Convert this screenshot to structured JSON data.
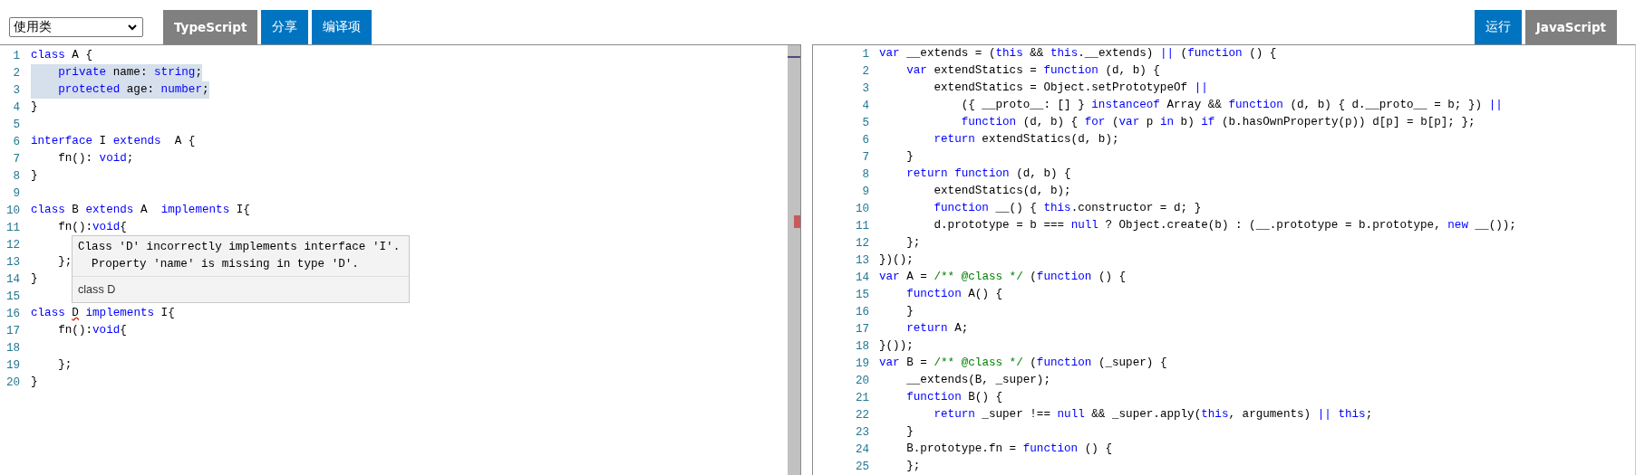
{
  "toolbar": {
    "select": {
      "value": "使用类"
    },
    "left_buttons": [
      {
        "label": "TypeScript",
        "kind": "language"
      },
      {
        "label": "分享",
        "kind": "action"
      },
      {
        "label": "编译项",
        "kind": "action"
      }
    ],
    "right_buttons": [
      {
        "label": "运行",
        "kind": "action"
      },
      {
        "label": "JavaScript",
        "kind": "language"
      }
    ]
  },
  "source_editor": {
    "lines": [
      {
        "number": "1",
        "selected": false,
        "tokens": [
          {
            "kind": "keyword",
            "text": "class"
          },
          {
            "kind": "plain",
            "text": " A {"
          }
        ]
      },
      {
        "number": "2",
        "selected": true,
        "tokens": [
          {
            "kind": "keyword",
            "text": "    private"
          },
          {
            "kind": "plain",
            "text": " name: "
          },
          {
            "kind": "keyword",
            "text": "string"
          },
          {
            "kind": "plain",
            "text": ";"
          }
        ]
      },
      {
        "number": "3",
        "selected": true,
        "tokens": [
          {
            "kind": "keyword",
            "text": "    protected"
          },
          {
            "kind": "plain",
            "text": " age: "
          },
          {
            "kind": "keyword",
            "text": "number"
          },
          {
            "kind": "plain",
            "text": ";"
          }
        ]
      },
      {
        "number": "4",
        "selected": false,
        "tokens": [
          {
            "kind": "plain",
            "text": "}"
          }
        ]
      },
      {
        "number": "5",
        "selected": false
      },
      {
        "number": "6",
        "selected": false,
        "tokens": [
          {
            "kind": "keyword",
            "text": "interface"
          },
          {
            "kind": "plain",
            "text": " I "
          },
          {
            "kind": "keyword",
            "text": "extends"
          },
          {
            "kind": "plain",
            "text": "  A {"
          }
        ]
      },
      {
        "number": "7",
        "selected": false,
        "tokens": [
          {
            "kind": "plain",
            "text": "    fn(): "
          },
          {
            "kind": "keyword",
            "text": "void"
          },
          {
            "kind": "plain",
            "text": ";"
          }
        ]
      },
      {
        "number": "8",
        "selected": false,
        "tokens": [
          {
            "kind": "plain",
            "text": "}"
          }
        ]
      },
      {
        "number": "9",
        "selected": false
      },
      {
        "number": "10",
        "selected": false,
        "tokens": [
          {
            "kind": "keyword",
            "text": "class"
          },
          {
            "kind": "plain",
            "text": " B "
          },
          {
            "kind": "keyword",
            "text": "extends"
          },
          {
            "kind": "plain",
            "text": " A  "
          },
          {
            "kind": "keyword",
            "text": "implements"
          },
          {
            "kind": "plain",
            "text": " I{"
          }
        ]
      },
      {
        "number": "11",
        "selected": false,
        "tokens": [
          {
            "kind": "plain",
            "text": "    fn():"
          },
          {
            "kind": "keyword",
            "text": "void"
          },
          {
            "kind": "plain",
            "text": "{"
          }
        ]
      },
      {
        "number": "12",
        "selected": false
      },
      {
        "number": "13",
        "selected": false,
        "tokens": [
          {
            "kind": "plain",
            "text": "    };"
          }
        ]
      },
      {
        "number": "14",
        "selected": false,
        "tokens": [
          {
            "kind": "plain",
            "text": "}"
          }
        ]
      },
      {
        "number": "15",
        "selected": false
      },
      {
        "number": "16",
        "selected": false,
        "tokens": [
          {
            "kind": "keyword",
            "text": "class "
          },
          {
            "kind": "error",
            "text": "D"
          },
          {
            "kind": "keyword",
            "text": " implements"
          },
          {
            "kind": "plain",
            "text": " I{"
          }
        ]
      },
      {
        "number": "17",
        "selected": false,
        "tokens": [
          {
            "kind": "plain",
            "text": "    fn():"
          },
          {
            "kind": "keyword",
            "text": "void"
          },
          {
            "kind": "plain",
            "text": "{"
          }
        ]
      },
      {
        "number": "18",
        "selected": false
      },
      {
        "number": "19",
        "selected": false,
        "tokens": [
          {
            "kind": "plain",
            "text": "    };"
          }
        ]
      },
      {
        "number": "20",
        "selected": false,
        "tokens": [
          {
            "kind": "plain",
            "text": "}"
          }
        ]
      }
    ],
    "tooltip": {
      "message": [
        "Class 'D' incorrectly implements interface 'I'.",
        "  Property 'name' is missing in type 'D'."
      ],
      "footer": "class D"
    }
  },
  "output_editor": {
    "lines": [
      {
        "number": "1",
        "tokens": [
          {
            "kind": "keyword",
            "text": "var"
          },
          {
            "kind": "plain",
            "text": " __extends = ("
          },
          {
            "kind": "keyword",
            "text": "this"
          },
          {
            "kind": "plain",
            "text": " && "
          },
          {
            "kind": "keyword",
            "text": "this"
          },
          {
            "kind": "plain",
            "text": ".__extends) "
          },
          {
            "kind": "keyword",
            "text": "||"
          },
          {
            "kind": "plain",
            "text": " ("
          },
          {
            "kind": "keyword",
            "text": "function"
          },
          {
            "kind": "plain",
            "text": " () {"
          }
        ]
      },
      {
        "number": "2",
        "tokens": [
          {
            "kind": "keyword",
            "text": "    var"
          },
          {
            "kind": "plain",
            "text": " extendStatics = "
          },
          {
            "kind": "keyword",
            "text": "function"
          },
          {
            "kind": "plain",
            "text": " (d, b) {"
          }
        ]
      },
      {
        "number": "3",
        "tokens": [
          {
            "kind": "plain",
            "text": "        extendStatics = Object.setPrototypeOf "
          },
          {
            "kind": "keyword",
            "text": "||"
          }
        ]
      },
      {
        "number": "4",
        "tokens": [
          {
            "kind": "plain",
            "text": "            ({ __proto__: [] } "
          },
          {
            "kind": "keyword",
            "text": "instanceof"
          },
          {
            "kind": "plain",
            "text": " Array && "
          },
          {
            "kind": "keyword",
            "text": "function"
          },
          {
            "kind": "plain",
            "text": " (d, b) { d.__proto__ = b; }) "
          },
          {
            "kind": "keyword",
            "text": "||"
          }
        ]
      },
      {
        "number": "5",
        "tokens": [
          {
            "kind": "keyword",
            "text": "            function"
          },
          {
            "kind": "plain",
            "text": " (d, b) { "
          },
          {
            "kind": "keyword",
            "text": "for"
          },
          {
            "kind": "plain",
            "text": " ("
          },
          {
            "kind": "keyword",
            "text": "var"
          },
          {
            "kind": "plain",
            "text": " p "
          },
          {
            "kind": "keyword",
            "text": "in"
          },
          {
            "kind": "plain",
            "text": " b) "
          },
          {
            "kind": "keyword",
            "text": "if"
          },
          {
            "kind": "plain",
            "text": " (b.hasOwnProperty(p)) d[p] = b[p]; };"
          }
        ]
      },
      {
        "number": "6",
        "tokens": [
          {
            "kind": "keyword",
            "text": "        return"
          },
          {
            "kind": "plain",
            "text": " extendStatics(d, b);"
          }
        ]
      },
      {
        "number": "7",
        "tokens": [
          {
            "kind": "plain",
            "text": "    }"
          }
        ]
      },
      {
        "number": "8",
        "tokens": [
          {
            "kind": "keyword",
            "text": "    return function"
          },
          {
            "kind": "plain",
            "text": " (d, b) {"
          }
        ]
      },
      {
        "number": "9",
        "tokens": [
          {
            "kind": "plain",
            "text": "        extendStatics(d, b);"
          }
        ]
      },
      {
        "number": "10",
        "tokens": [
          {
            "kind": "keyword",
            "text": "        function"
          },
          {
            "kind": "plain",
            "text": " __() { "
          },
          {
            "kind": "keyword",
            "text": "this"
          },
          {
            "kind": "plain",
            "text": ".constructor = d; }"
          }
        ]
      },
      {
        "number": "11",
        "tokens": [
          {
            "kind": "plain",
            "text": "        d.prototype = b === "
          },
          {
            "kind": "keyword",
            "text": "null"
          },
          {
            "kind": "plain",
            "text": " ? Object.create(b) : (__.prototype = b.prototype, "
          },
          {
            "kind": "keyword",
            "text": "new"
          },
          {
            "kind": "plain",
            "text": " __());"
          }
        ]
      },
      {
        "number": "12",
        "tokens": [
          {
            "kind": "plain",
            "text": "    };"
          }
        ]
      },
      {
        "number": "13",
        "tokens": [
          {
            "kind": "plain",
            "text": "})();"
          }
        ]
      },
      {
        "number": "14",
        "tokens": [
          {
            "kind": "keyword",
            "text": "var"
          },
          {
            "kind": "plain",
            "text": " A = "
          },
          {
            "kind": "comment",
            "text": "/** @class */"
          },
          {
            "kind": "plain",
            "text": " ("
          },
          {
            "kind": "keyword",
            "text": "function"
          },
          {
            "kind": "plain",
            "text": " () {"
          }
        ]
      },
      {
        "number": "15",
        "tokens": [
          {
            "kind": "keyword",
            "text": "    function"
          },
          {
            "kind": "plain",
            "text": " A() {"
          }
        ]
      },
      {
        "number": "16",
        "tokens": [
          {
            "kind": "plain",
            "text": "    }"
          }
        ]
      },
      {
        "number": "17",
        "tokens": [
          {
            "kind": "keyword",
            "text": "    return"
          },
          {
            "kind": "plain",
            "text": " A;"
          }
        ]
      },
      {
        "number": "18",
        "tokens": [
          {
            "kind": "plain",
            "text": "}());"
          }
        ]
      },
      {
        "number": "19",
        "tokens": [
          {
            "kind": "keyword",
            "text": "var"
          },
          {
            "kind": "plain",
            "text": " B = "
          },
          {
            "kind": "comment",
            "text": "/** @class */"
          },
          {
            "kind": "plain",
            "text": " ("
          },
          {
            "kind": "keyword",
            "text": "function"
          },
          {
            "kind": "plain",
            "text": " (_super) {"
          }
        ]
      },
      {
        "number": "20",
        "tokens": [
          {
            "kind": "plain",
            "text": "    __extends(B, _super);"
          }
        ]
      },
      {
        "number": "21",
        "tokens": [
          {
            "kind": "keyword",
            "text": "    function"
          },
          {
            "kind": "plain",
            "text": " B() {"
          }
        ]
      },
      {
        "number": "22",
        "tokens": [
          {
            "kind": "keyword",
            "text": "        return"
          },
          {
            "kind": "plain",
            "text": " _super !== "
          },
          {
            "kind": "keyword",
            "text": "null"
          },
          {
            "kind": "plain",
            "text": " && _super.apply("
          },
          {
            "kind": "keyword",
            "text": "this"
          },
          {
            "kind": "plain",
            "text": ", arguments) "
          },
          {
            "kind": "keyword",
            "text": "|| this"
          },
          {
            "kind": "plain",
            "text": ";"
          }
        ]
      },
      {
        "number": "23",
        "tokens": [
          {
            "kind": "plain",
            "text": "    }"
          }
        ]
      },
      {
        "number": "24",
        "tokens": [
          {
            "kind": "plain",
            "text": "    B.prototype.fn = "
          },
          {
            "kind": "keyword",
            "text": "function"
          },
          {
            "kind": "plain",
            "text": " () {"
          }
        ]
      },
      {
        "number": "25",
        "tokens": [
          {
            "kind": "plain",
            "text": "    };"
          }
        ]
      }
    ]
  }
}
